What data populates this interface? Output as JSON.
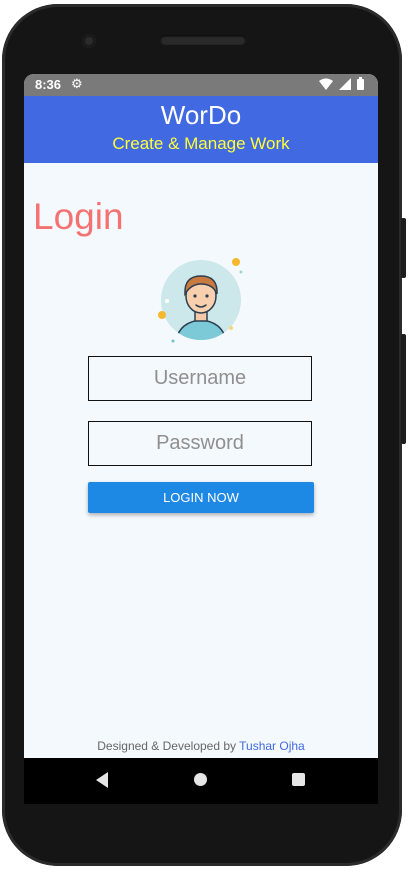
{
  "status_bar": {
    "time": "8:36",
    "settings_icon": "gear-icon",
    "wifi_icon": "wifi-icon",
    "signal_icon": "cell-signal-icon",
    "battery_icon": "battery-icon"
  },
  "app_bar": {
    "title": "WorDo",
    "subtitle": "Create & Manage Work"
  },
  "login": {
    "heading": "Login",
    "avatar_icon": "user-avatar-icon",
    "username_placeholder": "Username",
    "password_placeholder": "Password",
    "button_label": "LOGIN NOW"
  },
  "footer": {
    "prefix": "Designed & Developed by ",
    "author": "Tushar Ojha"
  },
  "nav_bar": {
    "back_icon": "back-icon",
    "home_icon": "home-icon",
    "recents_icon": "recents-icon"
  },
  "colors": {
    "app_bar": "#4169e1",
    "subtitle": "#ffff3a",
    "heading": "#f47272",
    "button": "#1e88e5",
    "background": "#f4f9fd"
  }
}
